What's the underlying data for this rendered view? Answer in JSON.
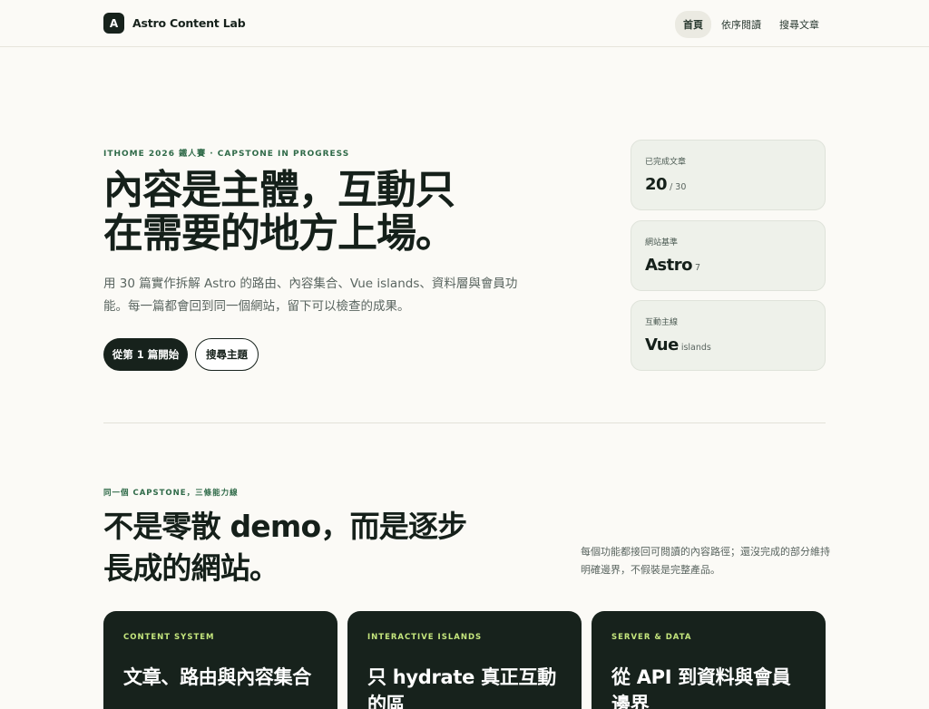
{
  "header": {
    "brand_mark": "A",
    "brand_name": "Astro Content Lab",
    "nav": [
      {
        "label": "首頁",
        "active": true
      },
      {
        "label": "依序閱讀",
        "active": false
      },
      {
        "label": "搜尋文章",
        "active": false
      }
    ]
  },
  "hero": {
    "eyebrow": "ITHOME 2026 鐵人賽 · CAPSTONE IN PROGRESS",
    "title_line1": "內容是主體，互動只",
    "title_line2": "在需要的地方上場。",
    "description": "用 30 篇實作拆解 Astro 的路由、內容集合、Vue islands、資料層與會員功能。每一篇都會回到同一個網站，留下可以檢查的成果。",
    "primary_button": "從第 1 篇開始",
    "secondary_button": "搜尋主題"
  },
  "stats": [
    {
      "label": "已完成文章",
      "value": "20",
      "suffix": "/ 30"
    },
    {
      "label": "網站基準",
      "value": "Astro",
      "suffix": "7"
    },
    {
      "label": "互動主線",
      "value": "Vue",
      "suffix": "islands"
    }
  ],
  "section": {
    "eyebrow": "同一個 CAPSTONE，三條能力線",
    "title_line1": "不是零散 demo，而是逐步",
    "title_line2": "長成的網站。",
    "description": "每個功能都接回可閱讀的內容路徑；還沒完成的部分維持明確邊界，不假裝是完整產品。"
  },
  "cards": [
    {
      "eyebrow": "CONTENT SYSTEM",
      "title": "文章、路由與內容集合"
    },
    {
      "eyebrow": "INTERACTIVE ISLANDS",
      "title": "只 hydrate 真正互動的區"
    },
    {
      "eyebrow": "SERVER & DATA",
      "title": "從 API 到資料與會員邊界"
    }
  ]
}
